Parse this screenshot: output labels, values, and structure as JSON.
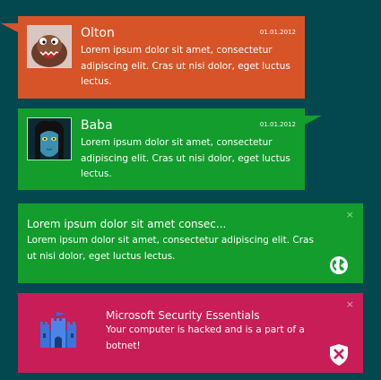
{
  "notifications": [
    {
      "name": "Olton",
      "date": "01.01.2012",
      "message": "Lorem ipsum dolor sit amet, consectetur adipiscing elit. Cras ut nisi dolor, eget luctus lectus.",
      "color": "#d75428"
    },
    {
      "name": "Baba",
      "date": "01.01.2012",
      "message": "Lorem ipsum dolor sit amet, consectetur adipiscing elit. Cras ut nisi dolor, eget luctus lectus.",
      "color": "#129d2d"
    },
    {
      "title": "Lorem ipsum dolor sit amet consec...",
      "message": "Lorem ipsum dolor sit amet, consectetur adipiscing elit. Cras ut nisi dolor, eget luctus lectus.",
      "close": "×",
      "icon": "globe-icon",
      "color": "#129d2d"
    },
    {
      "title": "Microsoft Security Essentials",
      "message": "Your computer is hacked and is a part of a botnet!",
      "close": "×",
      "icon": "shield-icon",
      "color": "#c81d56"
    }
  ],
  "background": "#03474f"
}
